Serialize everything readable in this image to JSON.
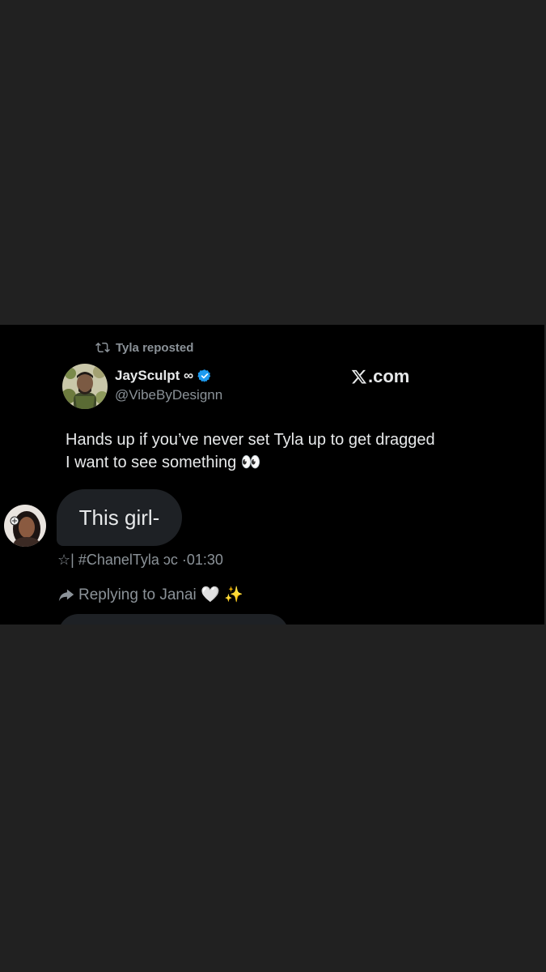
{
  "repost": {
    "icon": "repost-icon",
    "text": "Tyla reposted"
  },
  "author": {
    "name": "JaySculpt ∞",
    "handle": "@VibeByDesignn",
    "verified_color": "#1d9bf0"
  },
  "watermark": {
    "text": ".com",
    "icon": "x-logo-icon"
  },
  "tweet": {
    "text": "Hands up if you’ve never set Tyla up to get dragged I want to see something 👀"
  },
  "reply": {
    "bubble_text": "This girl-",
    "meta": "☆| #ChanelTyla ɔc ·01:30",
    "replying_to": "Replying to Janai 🤍 ✨"
  },
  "colors": {
    "background": "#212121",
    "card": "#000000",
    "muted_text": "#8b9298",
    "bubble": "#1e2125"
  }
}
